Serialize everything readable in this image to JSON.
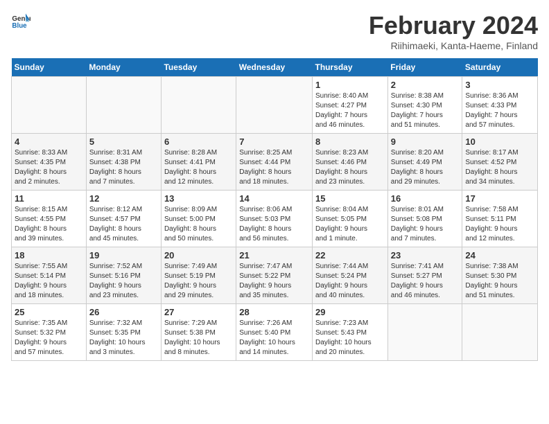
{
  "header": {
    "logo_line1": "General",
    "logo_line2": "Blue",
    "title": "February 2024",
    "subtitle": "Riihimaeki, Kanta-Haeme, Finland"
  },
  "days_of_week": [
    "Sunday",
    "Monday",
    "Tuesday",
    "Wednesday",
    "Thursday",
    "Friday",
    "Saturday"
  ],
  "weeks": [
    [
      {
        "day": "",
        "info": ""
      },
      {
        "day": "",
        "info": ""
      },
      {
        "day": "",
        "info": ""
      },
      {
        "day": "",
        "info": ""
      },
      {
        "day": "1",
        "info": "Sunrise: 8:40 AM\nSunset: 4:27 PM\nDaylight: 7 hours\nand 46 minutes."
      },
      {
        "day": "2",
        "info": "Sunrise: 8:38 AM\nSunset: 4:30 PM\nDaylight: 7 hours\nand 51 minutes."
      },
      {
        "day": "3",
        "info": "Sunrise: 8:36 AM\nSunset: 4:33 PM\nDaylight: 7 hours\nand 57 minutes."
      }
    ],
    [
      {
        "day": "4",
        "info": "Sunrise: 8:33 AM\nSunset: 4:35 PM\nDaylight: 8 hours\nand 2 minutes."
      },
      {
        "day": "5",
        "info": "Sunrise: 8:31 AM\nSunset: 4:38 PM\nDaylight: 8 hours\nand 7 minutes."
      },
      {
        "day": "6",
        "info": "Sunrise: 8:28 AM\nSunset: 4:41 PM\nDaylight: 8 hours\nand 12 minutes."
      },
      {
        "day": "7",
        "info": "Sunrise: 8:25 AM\nSunset: 4:44 PM\nDaylight: 8 hours\nand 18 minutes."
      },
      {
        "day": "8",
        "info": "Sunrise: 8:23 AM\nSunset: 4:46 PM\nDaylight: 8 hours\nand 23 minutes."
      },
      {
        "day": "9",
        "info": "Sunrise: 8:20 AM\nSunset: 4:49 PM\nDaylight: 8 hours\nand 29 minutes."
      },
      {
        "day": "10",
        "info": "Sunrise: 8:17 AM\nSunset: 4:52 PM\nDaylight: 8 hours\nand 34 minutes."
      }
    ],
    [
      {
        "day": "11",
        "info": "Sunrise: 8:15 AM\nSunset: 4:55 PM\nDaylight: 8 hours\nand 39 minutes."
      },
      {
        "day": "12",
        "info": "Sunrise: 8:12 AM\nSunset: 4:57 PM\nDaylight: 8 hours\nand 45 minutes."
      },
      {
        "day": "13",
        "info": "Sunrise: 8:09 AM\nSunset: 5:00 PM\nDaylight: 8 hours\nand 50 minutes."
      },
      {
        "day": "14",
        "info": "Sunrise: 8:06 AM\nSunset: 5:03 PM\nDaylight: 8 hours\nand 56 minutes."
      },
      {
        "day": "15",
        "info": "Sunrise: 8:04 AM\nSunset: 5:05 PM\nDaylight: 9 hours\nand 1 minute."
      },
      {
        "day": "16",
        "info": "Sunrise: 8:01 AM\nSunset: 5:08 PM\nDaylight: 9 hours\nand 7 minutes."
      },
      {
        "day": "17",
        "info": "Sunrise: 7:58 AM\nSunset: 5:11 PM\nDaylight: 9 hours\nand 12 minutes."
      }
    ],
    [
      {
        "day": "18",
        "info": "Sunrise: 7:55 AM\nSunset: 5:14 PM\nDaylight: 9 hours\nand 18 minutes."
      },
      {
        "day": "19",
        "info": "Sunrise: 7:52 AM\nSunset: 5:16 PM\nDaylight: 9 hours\nand 23 minutes."
      },
      {
        "day": "20",
        "info": "Sunrise: 7:49 AM\nSunset: 5:19 PM\nDaylight: 9 hours\nand 29 minutes."
      },
      {
        "day": "21",
        "info": "Sunrise: 7:47 AM\nSunset: 5:22 PM\nDaylight: 9 hours\nand 35 minutes."
      },
      {
        "day": "22",
        "info": "Sunrise: 7:44 AM\nSunset: 5:24 PM\nDaylight: 9 hours\nand 40 minutes."
      },
      {
        "day": "23",
        "info": "Sunrise: 7:41 AM\nSunset: 5:27 PM\nDaylight: 9 hours\nand 46 minutes."
      },
      {
        "day": "24",
        "info": "Sunrise: 7:38 AM\nSunset: 5:30 PM\nDaylight: 9 hours\nand 51 minutes."
      }
    ],
    [
      {
        "day": "25",
        "info": "Sunrise: 7:35 AM\nSunset: 5:32 PM\nDaylight: 9 hours\nand 57 minutes."
      },
      {
        "day": "26",
        "info": "Sunrise: 7:32 AM\nSunset: 5:35 PM\nDaylight: 10 hours\nand 3 minutes."
      },
      {
        "day": "27",
        "info": "Sunrise: 7:29 AM\nSunset: 5:38 PM\nDaylight: 10 hours\nand 8 minutes."
      },
      {
        "day": "28",
        "info": "Sunrise: 7:26 AM\nSunset: 5:40 PM\nDaylight: 10 hours\nand 14 minutes."
      },
      {
        "day": "29",
        "info": "Sunrise: 7:23 AM\nSunset: 5:43 PM\nDaylight: 10 hours\nand 20 minutes."
      },
      {
        "day": "",
        "info": ""
      },
      {
        "day": "",
        "info": ""
      }
    ]
  ]
}
